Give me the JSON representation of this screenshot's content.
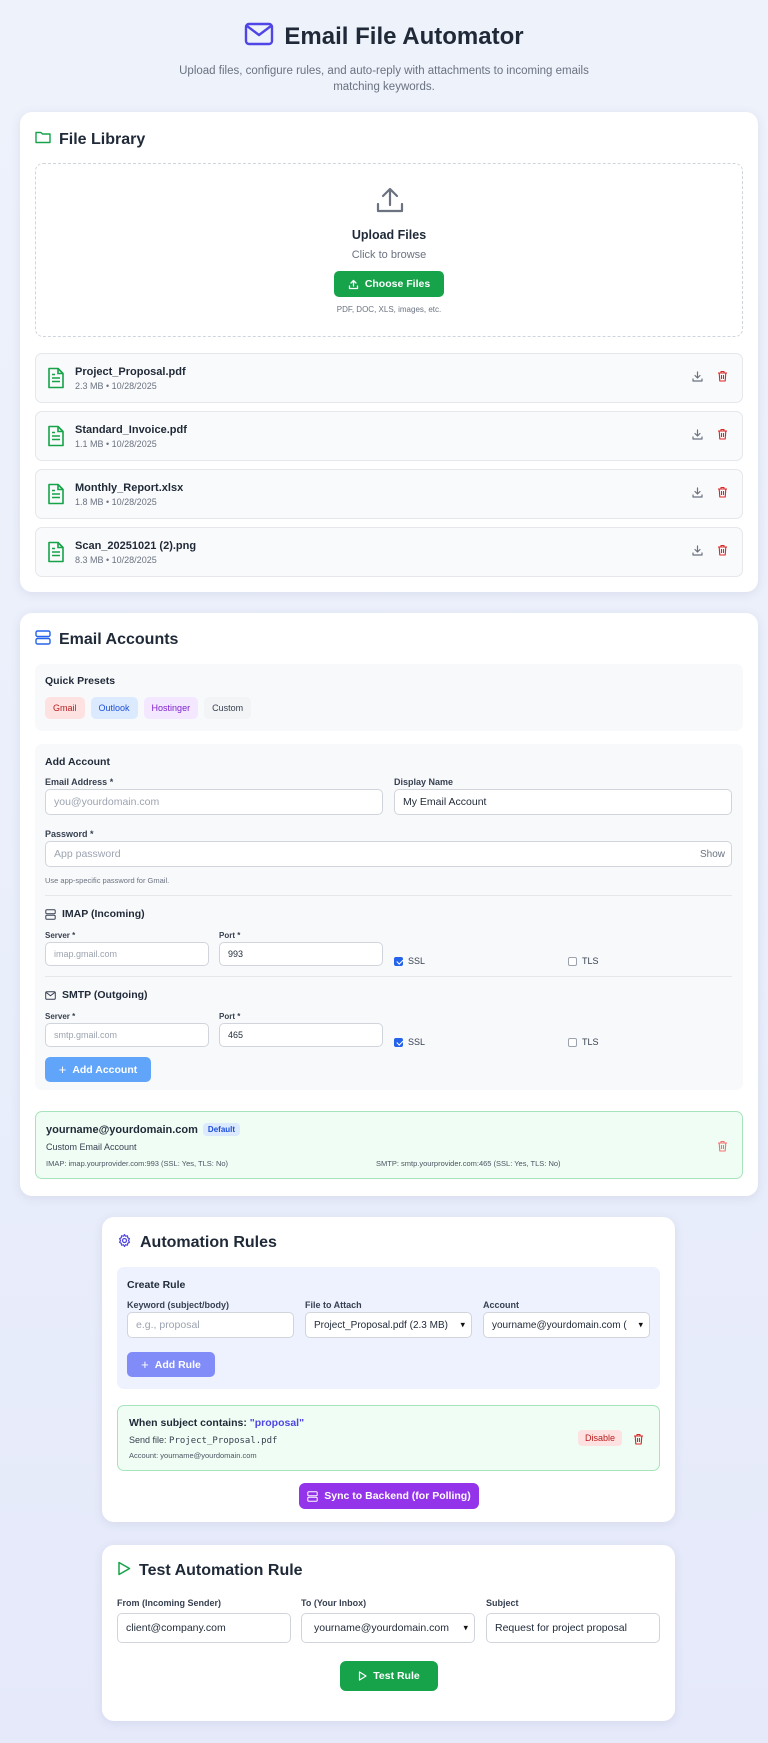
{
  "header": {
    "title": "Email File Automator",
    "subtitle": "Upload files, configure rules, and auto-reply with attachments to incoming emails matching keywords."
  },
  "file_library": {
    "title": "File Library",
    "upload_title": "Upload Files",
    "upload_sub": "Click to browse",
    "choose_label": "Choose Files",
    "hint": "PDF, DOC, XLS, images, etc.",
    "files": [
      {
        "name": "Project_Proposal.pdf",
        "meta": "2.3 MB • 10/28/2025"
      },
      {
        "name": "Standard_Invoice.pdf",
        "meta": "1.1 MB • 10/28/2025"
      },
      {
        "name": "Monthly_Report.xlsx",
        "meta": "1.8 MB • 10/28/2025"
      },
      {
        "name": "Scan_20251021 (2).png",
        "meta": "8.3 MB • 10/28/2025"
      }
    ]
  },
  "email_accounts": {
    "title": "Email Accounts",
    "quick_presets_label": "Quick Presets",
    "presets": [
      "Gmail",
      "Outlook",
      "Hostinger",
      "Custom"
    ],
    "add_account_label": "Add Account",
    "email_label": "Email Address *",
    "email_placeholder": "you@yourdomain.com",
    "display_label": "Display Name",
    "display_value": "My Email Account",
    "password_label": "Password *",
    "password_placeholder": "App password",
    "show_label": "Show",
    "password_hint": "Use app-specific password for Gmail.",
    "imap_title": "IMAP (Incoming)",
    "imap_server_label": "Server *",
    "imap_server_placeholder": "imap.gmail.com",
    "imap_port_label": "Port *",
    "imap_port_value": "993",
    "smtp_title": "SMTP (Outgoing)",
    "smtp_server_label": "Server *",
    "smtp_server_placeholder": "smtp.gmail.com",
    "smtp_port_label": "Port *",
    "smtp_port_value": "465",
    "ssl_label": "SSL",
    "tls_label": "TLS",
    "add_account_button": "Add Account",
    "account": {
      "email": "yourname@yourdomain.com",
      "badge": "Default",
      "name": "Custom Email Account",
      "imap": "IMAP: imap.yourprovider.com:993 (SSL: Yes, TLS: No)",
      "smtp": "SMTP: smtp.yourprovider.com:465 (SSL: Yes, TLS: No)"
    }
  },
  "automation_rules": {
    "title": "Automation Rules",
    "create_rule_label": "Create Rule",
    "keyword_label": "Keyword (subject/body)",
    "keyword_placeholder": "e.g., proposal",
    "file_label": "File to Attach",
    "file_value": "Project_Proposal.pdf (2.3 MB)",
    "account_label": "Account",
    "account_value": "yourname@yourdomain.com (",
    "add_rule_button": "Add Rule",
    "rule": {
      "when_prefix": "When subject contains:",
      "keyword": "\"proposal\"",
      "send_prefix": "Send file:",
      "send_file": "Project_Proposal.pdf",
      "account": "Account: yourname@yourdomain.com",
      "disable_label": "Disable"
    },
    "sync_button": "Sync to Backend (for Polling)"
  },
  "test_rule": {
    "title": "Test Automation Rule",
    "from_label": "From (Incoming Sender)",
    "from_value": "client@company.com",
    "to_label": "To (Your Inbox)",
    "to_value": "yourname@yourdomain.com",
    "subject_label": "Subject",
    "subject_value": "Request for project proposal",
    "test_button": "Test Rule"
  },
  "colors": {
    "accent_indigo": "#4f46e5",
    "green": "#16a34a",
    "red": "#dc2626",
    "purple": "#9333ea",
    "blue_button": "#60a5fa"
  }
}
